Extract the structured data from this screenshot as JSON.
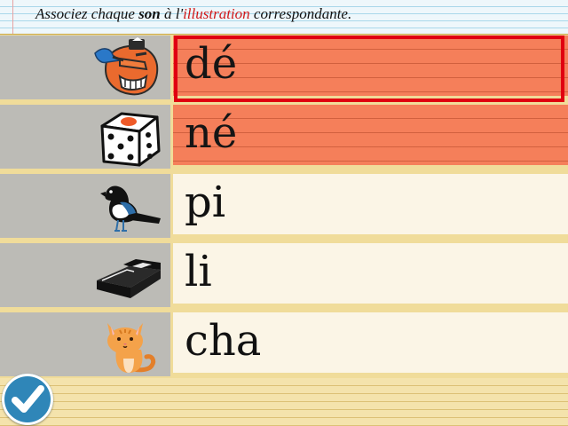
{
  "instruction": {
    "part1": "Associez chaque ",
    "part2": "son",
    "part3": " à l'",
    "part4": "illustration",
    "part5": " correspondante."
  },
  "rows": [
    {
      "word": "dé",
      "icon": "tengu-mask-icon",
      "selected": true
    },
    {
      "word": "né",
      "icon": "dice-icon",
      "selected": false
    },
    {
      "word": "pi",
      "icon": "magpie-icon",
      "selected": false
    },
    {
      "word": "li",
      "icon": "bed-icon",
      "selected": false
    },
    {
      "word": "cha",
      "icon": "cat-icon",
      "selected": false
    }
  ],
  "colors": {
    "highlight": "#f57f5a",
    "selection_border": "#e00010",
    "instruction_accent": "#d01818",
    "check_button": "#2f86b8"
  }
}
